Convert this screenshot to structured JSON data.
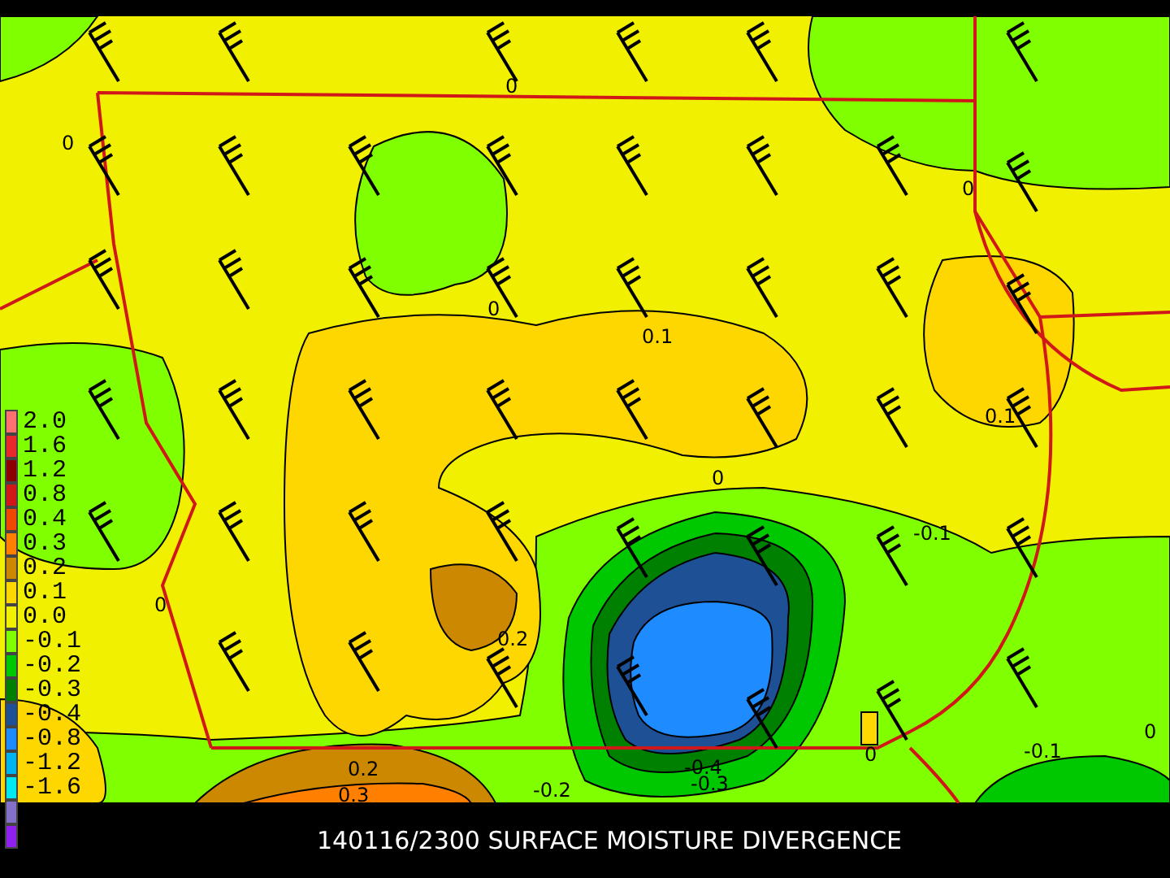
{
  "legend": [
    {
      "label": "2.0",
      "color": "#ff7070"
    },
    {
      "label": "1.6",
      "color": "#e8282d"
    },
    {
      "label": "1.2",
      "color": "#8b0000"
    },
    {
      "label": "0.8",
      "color": "#d01818"
    },
    {
      "label": "0.4",
      "color": "#f04800"
    },
    {
      "label": "0.3",
      "color": "#ff8000"
    },
    {
      "label": "0.2",
      "color": "#cc8800"
    },
    {
      "label": "0.1",
      "color": "#ffd700"
    },
    {
      "label": "0.0",
      "color": "#f0f000"
    },
    {
      "label": "-0.1",
      "color": "#80ff00"
    },
    {
      "label": "-0.2",
      "color": "#00c800"
    },
    {
      "label": "-0.3",
      "color": "#008000"
    },
    {
      "label": "-0.4",
      "color": "#1e5096"
    },
    {
      "label": "-0.8",
      "color": "#1e8cff"
    },
    {
      "label": "-1.2",
      "color": "#00b4f0"
    },
    {
      "label": "-1.6",
      "color": "#00e8f0"
    },
    {
      "color": "#8470c8"
    },
    {
      "color": "#9020f0"
    }
  ],
  "contour_labels": [
    "0",
    "0",
    "0",
    "0",
    "0.1",
    "0.1",
    "0",
    "-0.1",
    "0",
    "0.2",
    "0.2",
    "0.3",
    "-0.4",
    "-0.3",
    "-0.2",
    "0",
    "-0.1",
    "0"
  ],
  "caption": "140116/2300 SURFACE MOISTURE DIVERGENCE"
}
